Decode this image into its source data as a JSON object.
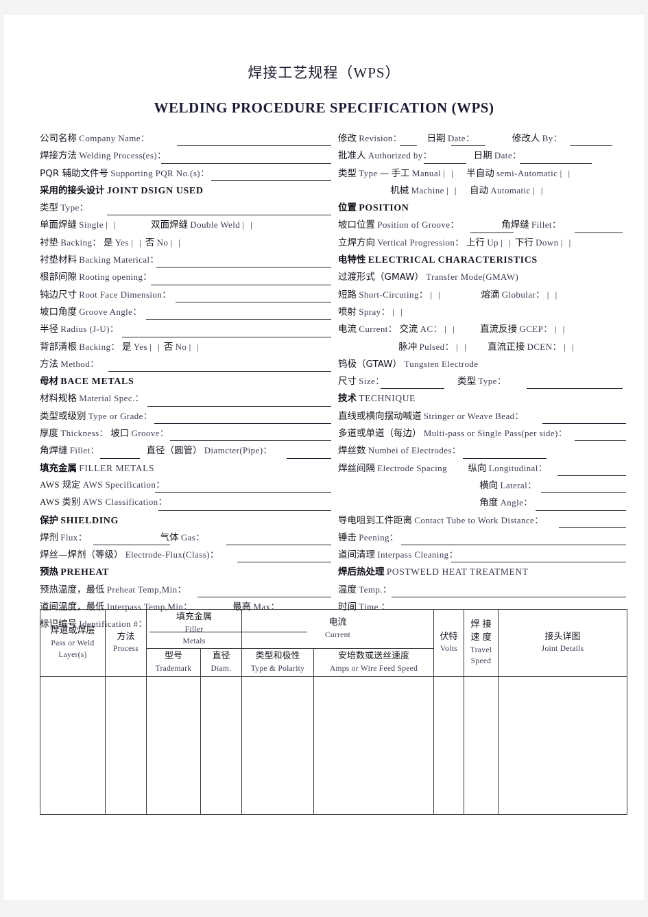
{
  "document": {
    "title_cn": "焊接工艺规程（WPS）",
    "title_en": "WELDING  PROCEDURE  SPECIFICATION  (WPS)"
  },
  "left_column": [
    {
      "cn": "公司名称",
      "en": "Company  Name：",
      "type": "field"
    },
    {
      "cn": "焊接方法",
      "en": "Welding  Process(es)：",
      "type": "field"
    },
    {
      "cn": "PQR 辅助文件号",
      "en": "Supporting  PQR  No.(s)：",
      "type": "field"
    },
    {
      "cn": "采用的接头设计",
      "en": "JOINT  DSIGN  USED",
      "type": "section"
    },
    {
      "cn": "类型",
      "en": "Type：",
      "type": "field"
    },
    {
      "cn": "单面焊缝",
      "en": "Single",
      "cn2": "双面焊缝",
      "en2": "Double  Weld",
      "type": "checkpair"
    },
    {
      "cn": "衬垫",
      "en": "Backing：",
      "yes_cn": "是",
      "yes_en": "Yes",
      "no_cn": "否",
      "no_en": "No",
      "type": "yesno"
    },
    {
      "cn": "衬垫材料",
      "en": "Backing  Materical：",
      "type": "field"
    },
    {
      "cn": "根部间隙",
      "en": "Rooting  opening：",
      "type": "field"
    },
    {
      "cn": "钝边尺寸",
      "en": "Root  Face  Dimension：",
      "type": "field"
    },
    {
      "cn": "坡口角度",
      "en": "Groove  Angle：",
      "type": "field"
    },
    {
      "cn": "半径",
      "en": "Radius  (J-U)：",
      "type": "field"
    },
    {
      "cn": "背部清根",
      "en": "Backing：",
      "yes_cn": "是",
      "yes_en": "Yes",
      "no_cn": "否",
      "no_en": "No",
      "type": "yesno"
    },
    {
      "cn": "方法",
      "en": "Method：",
      "type": "field"
    },
    {
      "cn": "母材",
      "en": "BACE  METALS",
      "type": "section"
    },
    {
      "cn": "材料规格",
      "en": "Material  Spec.：",
      "type": "field"
    },
    {
      "cn": "类型或级别",
      "en": "Type  or  Grade：",
      "type": "field"
    },
    {
      "cn": "厚度",
      "en": "Thickness：",
      "cn2": "坡口",
      "en2": "Groove：",
      "type": "field2"
    },
    {
      "cn": "角焊缝",
      "en": "Fillet：",
      "cn2": "直径（圆管）",
      "en2": "Diamcter(Pipe)：",
      "type": "field2"
    },
    {
      "cn": "填充金属",
      "en": "FILLER  METALS",
      "type": "section_thin"
    },
    {
      "cn": "AWS  规定",
      "en": "AWS  Specification：",
      "type": "field"
    },
    {
      "cn": "AWS  类别",
      "en": "AWS  Classification：",
      "type": "field"
    },
    {
      "cn": "保护",
      "en": "SHIELDING",
      "type": "section"
    },
    {
      "cn": "焊剂",
      "en": "Flux：",
      "cn2": "气体",
      "en2": "Gas：",
      "type": "field2"
    },
    {
      "cn": "焊丝—焊剂（等级）",
      "en": "Electrode-Flux(Class)：",
      "type": "field"
    },
    {
      "cn": "预热",
      "en": "PREHEAT",
      "type": "section"
    },
    {
      "cn": "预热温度，最低",
      "en": "Preheat  Temp,Min：",
      "type": "field"
    },
    {
      "cn": "道间温度，最低",
      "en": "Interpass  Temp,Min：",
      "cn2": "最高",
      "en2": "Max：",
      "type": "field2"
    },
    {
      "cn": "标识编号",
      "en": "Identification  #：",
      "type": "field"
    }
  ],
  "right_column": [
    {
      "cn": "修改",
      "en": "Revision：",
      "cn2": "日期",
      "en2": "Date：",
      "cn3": "修改人",
      "en3": "By：",
      "type": "field3"
    },
    {
      "cn": "批准人",
      "en": "Authorized  by：",
      "cn2": "日期",
      "en2": "Date：",
      "type": "field2"
    },
    {
      "cn": "类型",
      "en": "Type",
      "sep": "—",
      "cn2": "手工",
      "en2": "Manual",
      "cn3": "半自动",
      "en3": "semi-Automatic",
      "type": "typecheck"
    },
    {
      "cn": "机械",
      "en": "Machine",
      "cn2": "自动",
      "en2": "Automatic",
      "type": "typecheck2"
    },
    {
      "cn": "位置",
      "en": "POSITION",
      "type": "section"
    },
    {
      "cn": "坡口位置",
      "en": "Position  of  Groove：",
      "cn2": "角焊缝",
      "en2": "Fillet：",
      "type": "field2"
    },
    {
      "cn": "立焊方向",
      "en": "Vertical  Progression：",
      "cn2": "上行",
      "en2": "Up",
      "cn3": "下行",
      "en3": "Down",
      "type": "updown"
    },
    {
      "cn": "电特性",
      "en": "ELECTRICAL  CHARACTERISTICS",
      "type": "section"
    },
    {
      "cn": "过渡形式（GMAW）",
      "en": "Transfer  Mode(GMAW)",
      "type": "plain"
    },
    {
      "cn": "短路",
      "en": "Short-Circuting：",
      "cn2": "熔滴",
      "en2": "Globular：",
      "type": "boxpair"
    },
    {
      "cn": "喷射",
      "en": "Spray：",
      "type": "boxsingle"
    },
    {
      "cn": "电流",
      "en": "Current：",
      "cn2": "交流",
      "en2": "AC：",
      "cn3": "直流反接",
      "en3": "GCEP：",
      "type": "currentrow"
    },
    {
      "cn": "脉冲",
      "en": "Pulsed：",
      "cn2": "直流正接",
      "en2": "DCEN：",
      "type": "currentrow2"
    },
    {
      "cn": "钨极（GTAW）",
      "en": "Tungsten  Electrode",
      "type": "plain"
    },
    {
      "cn": "尺寸",
      "en": "Size：",
      "cn2": "类型",
      "en2": "Type：",
      "type": "field2"
    },
    {
      "cn": "技术",
      "en": "TECHNIQUE",
      "type": "section_thin"
    },
    {
      "cn": "直线或横向摆动喊道",
      "en": "Stringer  or  Weave  Bead：",
      "type": "field"
    },
    {
      "cn": "多道或单道（每边）",
      "en": "Multi-pass  or  Single  Pass(per  side)：",
      "type": "field"
    },
    {
      "cn": "焊丝数",
      "en": "Numbei  of  Electrodes：",
      "type": "field"
    },
    {
      "cn": "焊丝间隔",
      "en": "Electrode  Spacing",
      "cn2": "纵向",
      "en2": "Longitudinal：",
      "type": "field2"
    },
    {
      "cn": "横向",
      "en": "Lateral：",
      "type": "indent_field"
    },
    {
      "cn": "角度",
      "en": "Angle：",
      "type": "indent_field"
    },
    {
      "cn": "导电咀到工件距离",
      "en": "Contact  Tube  to  Work  Distance：",
      "type": "field"
    },
    {
      "cn": "锤击",
      "en": "Peening：",
      "type": "field"
    },
    {
      "cn": "道间清理",
      "en": "Interpass  Cleaning：",
      "type": "field"
    },
    {
      "cn": "焊后热处理",
      "en": "POSTWELD  HEAT  TREATMENT",
      "type": "section_thin"
    },
    {
      "cn": "温度",
      "en": "Temp.：",
      "type": "field"
    },
    {
      "cn": "时间",
      "en": "Time  ：",
      "type": "field"
    }
  ],
  "table": {
    "headers": [
      {
        "cn": "焊道或焊层",
        "en": "Pass  or  Weld",
        "en2": "Layer(s)"
      },
      {
        "cn": "方法",
        "en": "Process"
      },
      {
        "cn": "填充金属",
        "en": "Filler",
        "en2": "Metals"
      },
      {
        "cn": "电流",
        "en": "Current"
      },
      {
        "cn": "伏特",
        "en": "Volts"
      },
      {
        "cn": "焊 接",
        "cn2": "速 度",
        "en": "Travel",
        "en2": "Speed"
      },
      {
        "cn": "接头详图",
        "en": "Joint  Details"
      }
    ],
    "subheaders": [
      {
        "cn": "型号",
        "en": "Trademark"
      },
      {
        "cn": "直径",
        "en": "Diam."
      },
      {
        "cn": "类型和极性",
        "en": "Type  &  Polarity"
      },
      {
        "cn": "安培数或送丝速度",
        "en": "Amps  or  Wire  Feed  Speed"
      }
    ]
  },
  "symbols": {
    "checkbox": "|    |",
    "dash": "—"
  },
  "colors": {
    "text_dark": "#15151f",
    "text_en": "#3a3a52",
    "rule": "#202030",
    "table_border": "#3a3a3a",
    "page_bg": "#ffffff",
    "canvas_bg": "#f4f4f4"
  }
}
